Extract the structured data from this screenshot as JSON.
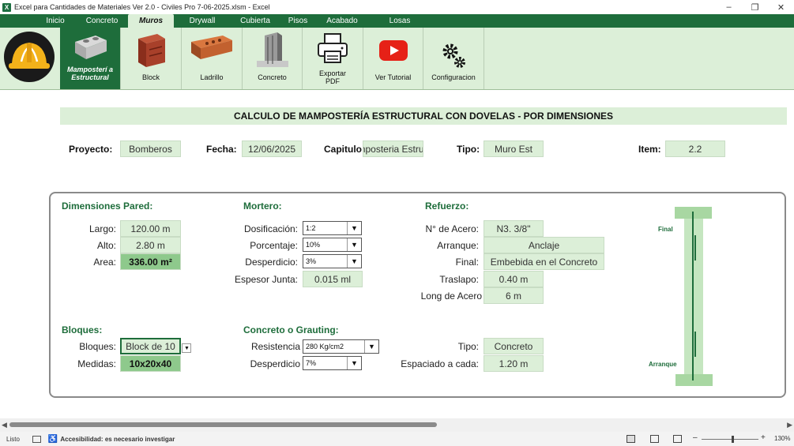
{
  "window": {
    "title": "Excel para Cantidades de Materiales Ver 2.0 - Civiles Pro 7-06-2025.xlsm - Excel",
    "app_icon": "excel-icon"
  },
  "tabs": [
    "Inicio",
    "Concreto",
    "Muros",
    "Drywall",
    "Cubierta",
    "Pisos",
    "Acabado",
    "Losas"
  ],
  "ribbon": {
    "mamposteria": "Mamposterí a Estructural",
    "block": "Block",
    "ladrillo": "Ladrillo",
    "concreto": "Concreto",
    "exportar": "Exportar PDF",
    "tutorial": "Ver Tutorial",
    "config": "Configuracion"
  },
  "banner": "CALCULO DE MAMPOSTERÍA ESTRUCTURAL CON DOVELAS - POR DIMENSIONES",
  "header": {
    "proyecto_label": "Proyecto:",
    "proyecto": "Bomberos",
    "fecha_label": "Fecha:",
    "fecha": "12/06/2025",
    "capitulo_label": "Capitulo",
    "capitulo": "mposteria Estruc",
    "tipo_label": "Tipo:",
    "tipo": "Muro Est",
    "item_label": "Item:",
    "item": "2.2"
  },
  "dimensiones": {
    "title": "Dimensiones Pared:",
    "largo_label": "Largo:",
    "largo": "120.00 m",
    "alto_label": "Alto:",
    "alto": "2.80 m",
    "area_label": "Area:",
    "area": "336.00 m²"
  },
  "mortero": {
    "title": "Mortero:",
    "dosif_label": "Dosificación:",
    "dosif": "1:2",
    "porc_label": "Porcentaje:",
    "porc": "10%",
    "desp_label": "Desperdicio:",
    "desp": "3%",
    "junta_label": "Espesor Junta:",
    "junta": "0.015 ml"
  },
  "refuerzo": {
    "title": "Refuerzo:",
    "acero_label": "N° de Acero:",
    "acero": "N3. 3/8\"",
    "arranque_label": "Arranque:",
    "arranque": "Anclaje",
    "final_label": "Final:",
    "final": "Embebida en el Concreto",
    "traslapo_label": "Traslapo:",
    "traslapo": "0.40 m",
    "long_label": "Long de Acero",
    "long": "6 m"
  },
  "bloques": {
    "title": "Bloques:",
    "bloques_label": "Bloques:",
    "bloques": "Block de 10",
    "medidas_label": "Medidas:",
    "medidas": "10x20x40"
  },
  "grauting": {
    "title": "Concreto o Grauting:",
    "resist_label": "Resistencia",
    "resist": "280 Kg/cm2",
    "desp_label": "Desperdicio",
    "desp": "7%",
    "tipo_label": "Tipo:",
    "tipo": "Concreto",
    "esp_label": "Espaciado a cada:",
    "esp": "1.20 m"
  },
  "diagram": {
    "final": "Final",
    "arranque": "Arranque"
  },
  "status": {
    "ready": "Listo",
    "accessibility": "Accesibilidad: es necesario investigar",
    "zoom": "130%"
  }
}
